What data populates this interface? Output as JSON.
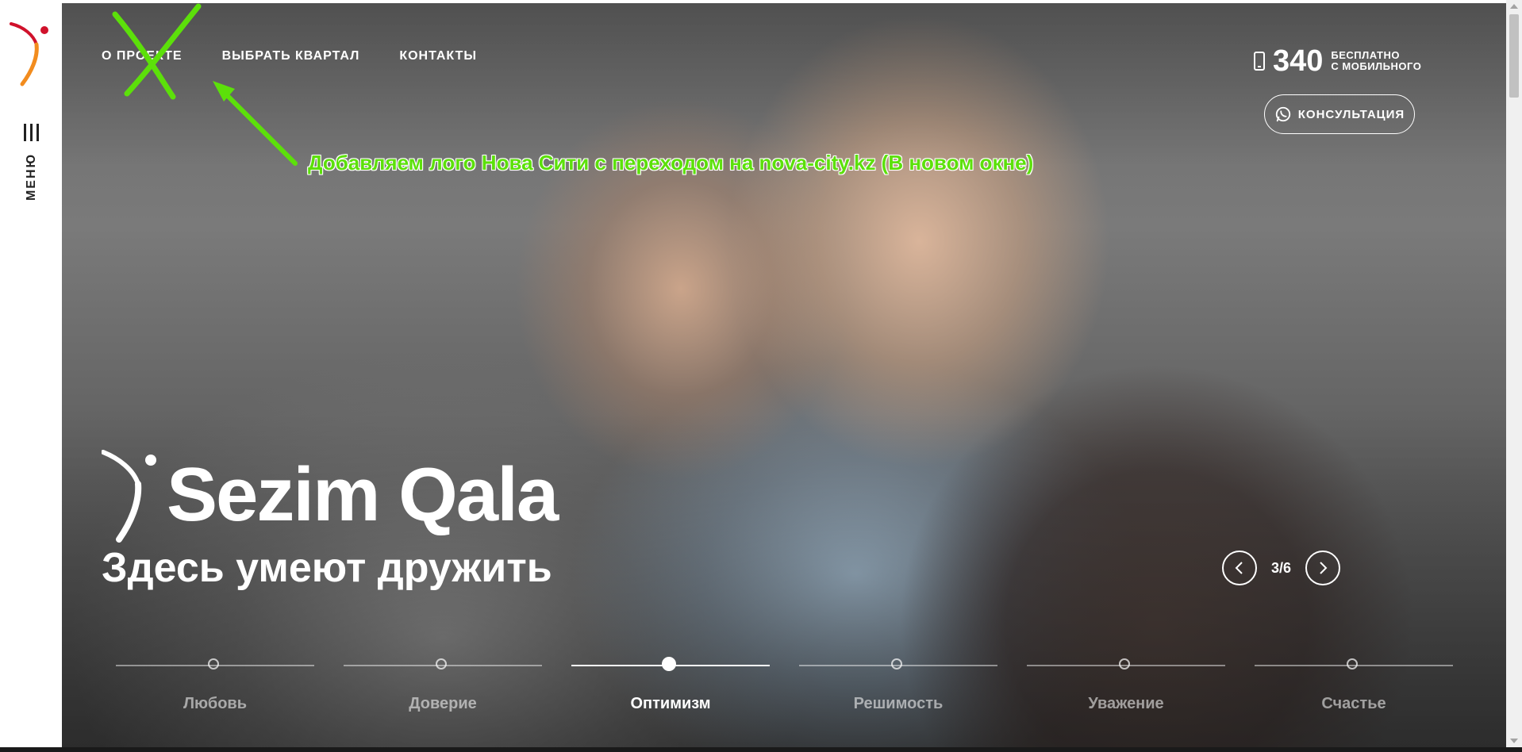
{
  "sidebar": {
    "menu_label": "МЕНЮ"
  },
  "nav": {
    "items": [
      {
        "label": "О ПРОЕКТЕ"
      },
      {
        "label": "ВЫБРАТЬ КВАРТАЛ"
      },
      {
        "label": "КОНТАКТЫ"
      }
    ]
  },
  "phone": {
    "number": "340",
    "note_line1": "БЕСПЛАТНО",
    "note_line2": "С МОБИЛЬНОГО"
  },
  "consult": {
    "label": "КОНСУЛЬТАЦИЯ"
  },
  "annotation": {
    "text": "Добавляем лого Нова Сити с переходом на nova-city.kz (В новом окне)"
  },
  "hero": {
    "brand": "Sezim Qala",
    "slogan": "Здесь умеют дружить"
  },
  "slider": {
    "counter": "3/6"
  },
  "tabs": [
    {
      "label": "Любовь"
    },
    {
      "label": "Доверие"
    },
    {
      "label": "Оптимизм"
    },
    {
      "label": "Решимость"
    },
    {
      "label": "Уважение"
    },
    {
      "label": "Счастье"
    }
  ],
  "active_tab": 2,
  "colors": {
    "annotation_green": "#5ce00a",
    "logo_red": "#d0112b",
    "logo_orange": "#f28c1e"
  }
}
